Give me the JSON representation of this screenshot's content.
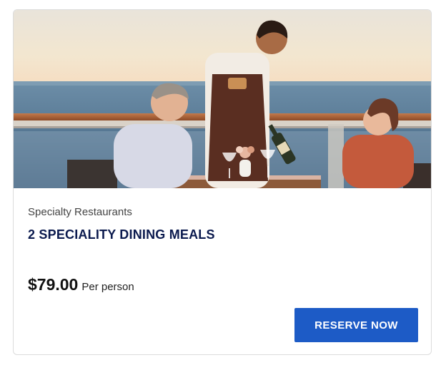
{
  "card": {
    "image_alt": "Waiter serving wine to a couple on a ship deck",
    "category": "Specialty Restaurants",
    "title": "2 SPECIALITY DINING MEALS",
    "price": "$79.00",
    "price_unit": "Per person",
    "reserve_label": "RESERVE NOW"
  },
  "colors": {
    "title": "#0b1a4e",
    "button": "#1d5bc6",
    "border": "#dcdcdc"
  }
}
